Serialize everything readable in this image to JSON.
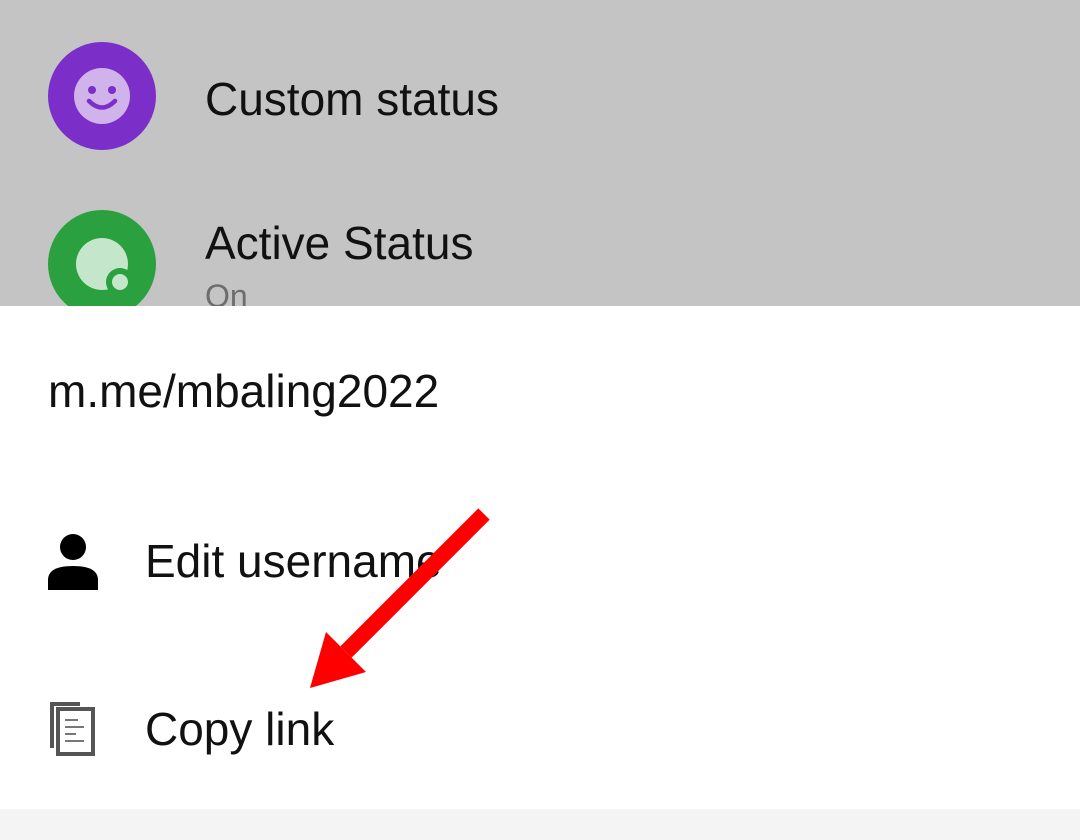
{
  "background_list": {
    "items": [
      {
        "label": "Custom status",
        "icon": "smiley-icon",
        "icon_color": "#7c2fc8"
      },
      {
        "label": "Active Status",
        "sublabel": "On",
        "icon": "active-status-icon",
        "icon_color": "#2aa13e"
      }
    ]
  },
  "sheet": {
    "link": "m.me/mbaling2022",
    "menu": [
      {
        "label": "Edit username",
        "icon": "person-icon"
      },
      {
        "label": "Copy link",
        "icon": "copy-icon"
      }
    ]
  },
  "annotation": {
    "arrow_color": "#ff0000",
    "points_to": "Copy link"
  },
  "colors": {
    "backdrop": "#c4c4c4",
    "sheet": "#ffffff",
    "text": "#111111",
    "subtext": "#6d6d6d"
  }
}
